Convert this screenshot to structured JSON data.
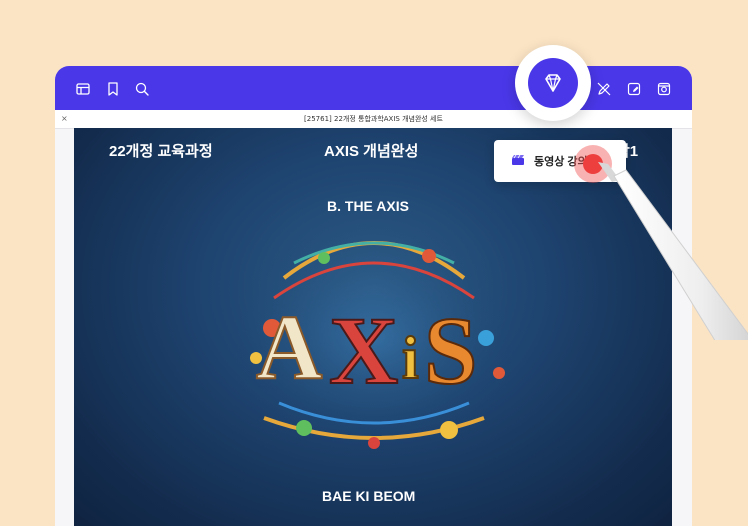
{
  "toolbar": {
    "left_icons": [
      "sidebar-icon",
      "bookmark-icon",
      "search-icon"
    ],
    "center_icon": "diamond-icon",
    "right_icons": [
      "pen-off-icon",
      "edit-page-icon",
      "settings-icon"
    ],
    "accent_color": "#4a37e8"
  },
  "document": {
    "title": "[25761] 22개정 통합과학AXIS 개념완성 세트",
    "close_label": "×"
  },
  "cover": {
    "curriculum": "22개정 교육과정",
    "series": "AXIS 개념완성",
    "subject": "학1",
    "publisher": "B. THE AXIS",
    "author": "BAE KI BEOM",
    "art_letters": [
      "A",
      "X",
      "i",
      "S"
    ]
  },
  "popup": {
    "label": "동영상 강의",
    "icon": "clapperboard-icon"
  },
  "colors": {
    "background": "#fbe4c4",
    "toolbar": "#4a37e8",
    "tap": "#ee3f3f"
  }
}
